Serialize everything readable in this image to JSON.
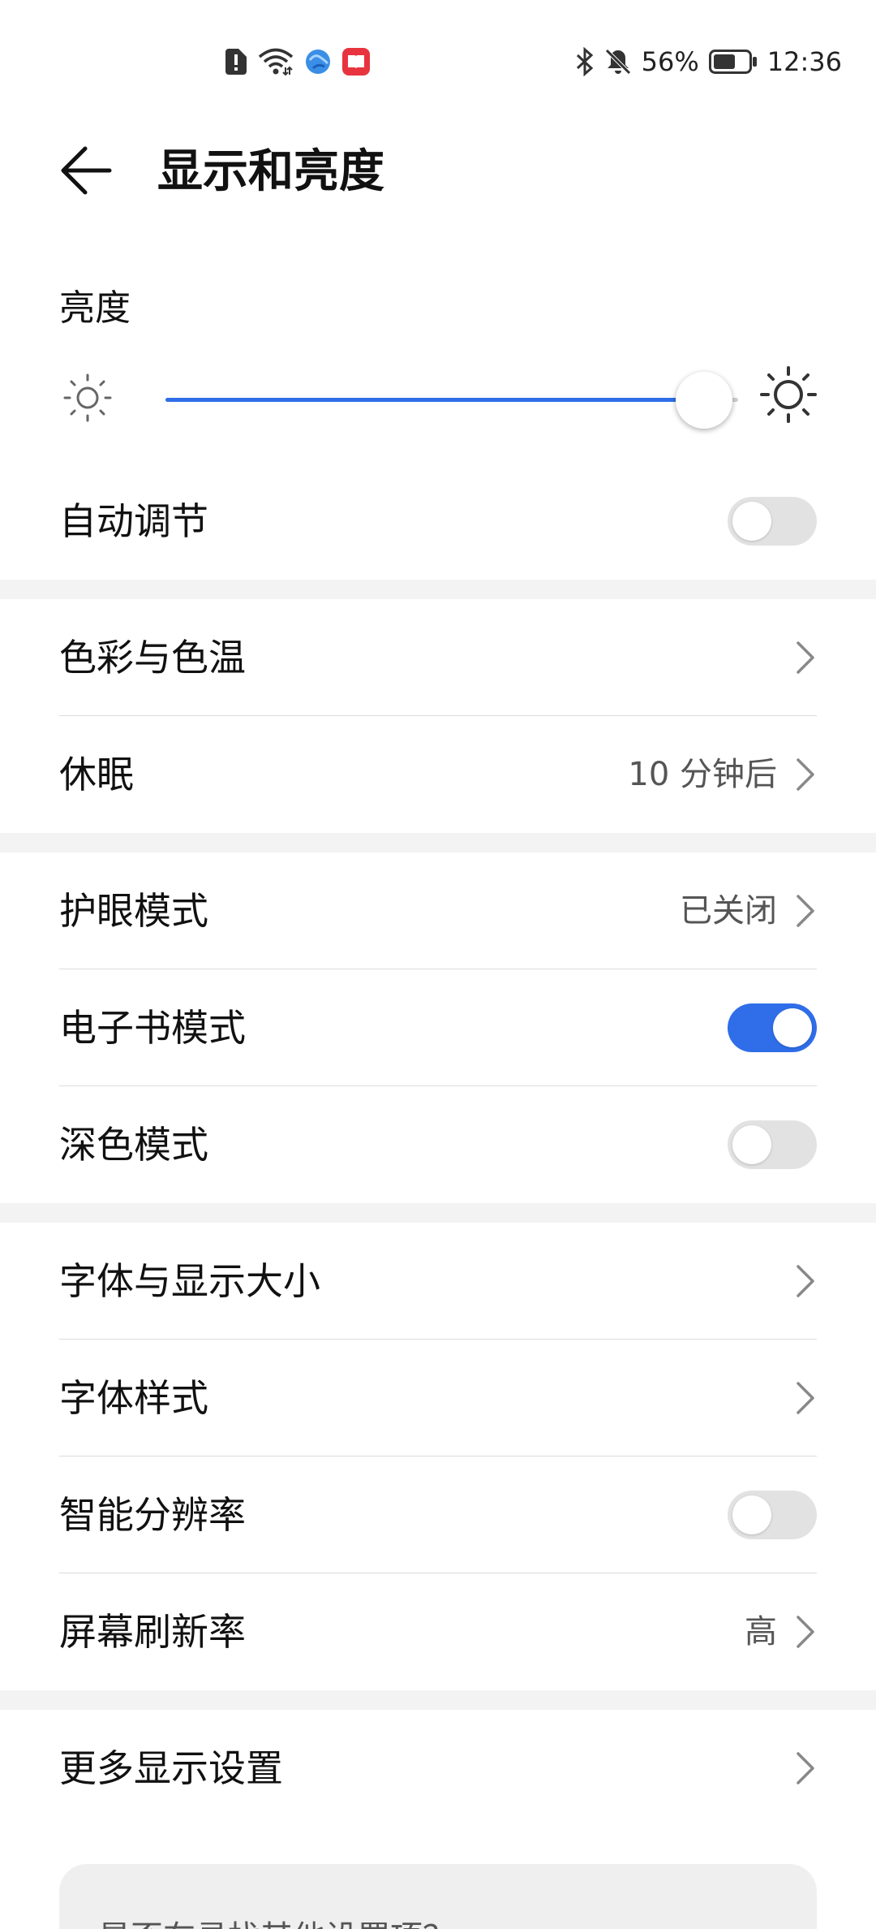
{
  "status_bar": {
    "icons_left": [
      "sim-alert-icon",
      "wifi-icon",
      "browser-icon",
      "book-app-icon"
    ],
    "icons_right": [
      "bluetooth-icon",
      "mute-bell-icon",
      "battery-icon"
    ],
    "battery": "56%",
    "time": "12:36"
  },
  "header": {
    "title": "显示和亮度"
  },
  "brightness": {
    "label": "亮度",
    "level_fraction": 0.94
  },
  "rows": {
    "auto_adjust": {
      "label": "自动调节",
      "toggle_on": false
    },
    "color_temp": {
      "label": "色彩与色温"
    },
    "sleep": {
      "label": "休眠",
      "value": "10 分钟后"
    },
    "eye_comfort": {
      "label": "护眼模式",
      "value": "已关闭"
    },
    "ebook": {
      "label": "电子书模式",
      "toggle_on": true
    },
    "dark_mode": {
      "label": "深色模式",
      "toggle_on": false
    },
    "font_size": {
      "label": "字体与显示大小"
    },
    "font_style": {
      "label": "字体样式"
    },
    "smart_resolution": {
      "label": "智能分辨率",
      "toggle_on": false
    },
    "refresh_rate": {
      "label": "屏幕刷新率",
      "value": "高"
    },
    "more_display": {
      "label": "更多显示设置"
    }
  },
  "search_card": {
    "text": "是否在寻找其他设置项？"
  },
  "colors": {
    "accent": "#2f6ee8",
    "toggle_off": "#e2e2e2",
    "page_gap": "#f3f3f3"
  }
}
